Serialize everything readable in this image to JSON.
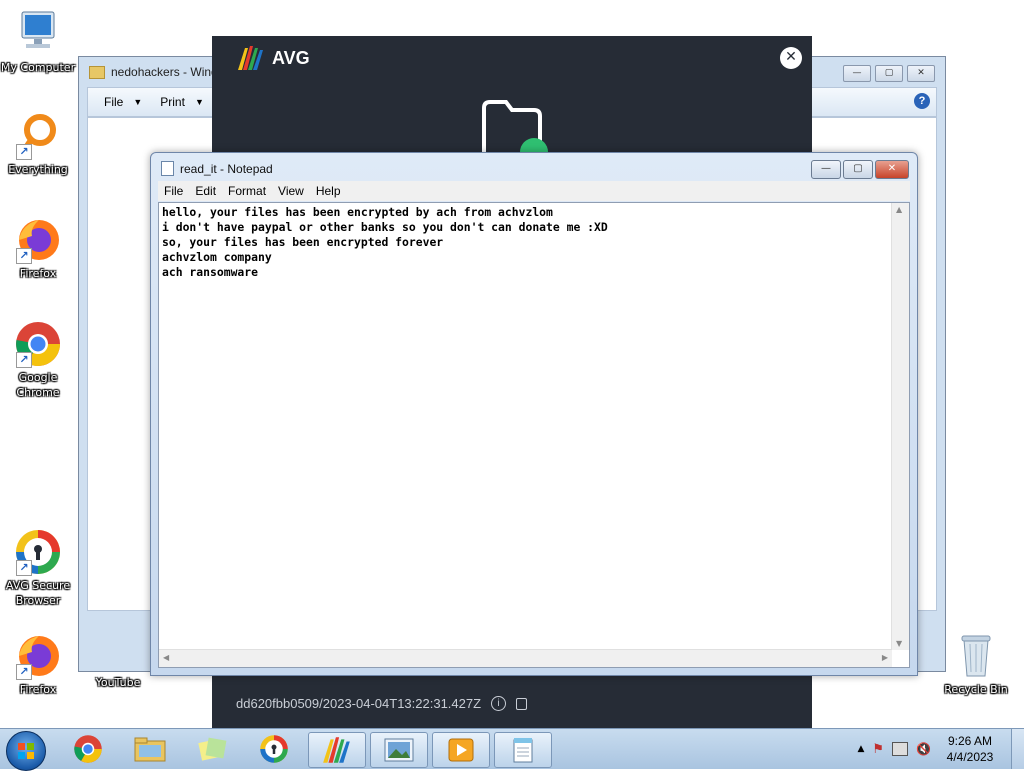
{
  "desktop": {
    "icons": [
      {
        "label": "My Computer"
      },
      {
        "label": "Everything"
      },
      {
        "label": "Firefox"
      },
      {
        "label": "Google Chrome"
      },
      {
        "label": "AVG Secure Browser"
      },
      {
        "label": "Firefox"
      },
      {
        "label": "YouTube"
      },
      {
        "label": "Recycle Bin"
      }
    ]
  },
  "explorer": {
    "title": "nedohackers - Windo",
    "menu": {
      "file": "File",
      "print": "Print"
    }
  },
  "avg": {
    "brand": "AVG",
    "footer_id": "dd620fbb0509/2023-04-04T13:22:31.427Z",
    "colors": {
      "background": "#262c36",
      "accent": "#2fbf71"
    }
  },
  "notepad": {
    "title": "read_it - Notepad",
    "menu": [
      "File",
      "Edit",
      "Format",
      "View",
      "Help"
    ],
    "lines": [
      "hello, your files has been encrypted by ach from achvzlom",
      "i don't have paypal or other banks so you don't can donate me :XD",
      "so, your files has been encrypted forever",
      "achvzlom company",
      "ach ransomware"
    ]
  },
  "taskbar": {
    "items": [
      "start-orb",
      "chrome-icon",
      "explorer-icon",
      "sticky-notes-icon",
      "avg-browser-icon",
      "avg-icon",
      "image-viewer-icon",
      "media-player-icon",
      "notepad-icon"
    ],
    "clock": {
      "time": "9:26 AM",
      "date": "4/4/2023"
    }
  }
}
